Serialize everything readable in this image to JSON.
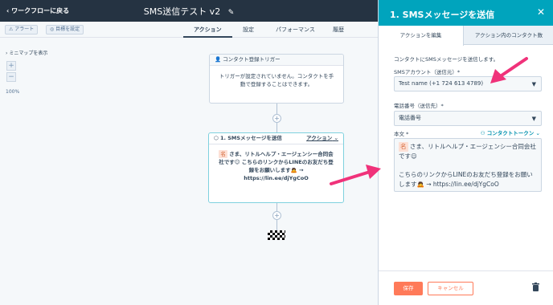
{
  "topbar": {
    "back_label": "‹ ワークフローに戻る",
    "title": "SMS送信テスト v2"
  },
  "toolbar": {
    "alert_label": "⚠ アラート",
    "goal_label": "◎ 目標を設定",
    "tabs": [
      {
        "label": "アクション",
        "active": true
      },
      {
        "label": "設定"
      },
      {
        "label": "パフォーマンス"
      },
      {
        "label": "履歴"
      }
    ]
  },
  "canvas": {
    "minimap_label": "ミニマップを表示",
    "zoom_in": "+",
    "zoom_out": "−",
    "zoom_level": "100%"
  },
  "trigger_card": {
    "title": "コンタクト登録トリガー",
    "body": "トリガーが設定されていません。コンタクトを手動で登録することはできます。"
  },
  "sms_card": {
    "title": "1. SMSメッセージを送信",
    "action_label": "アクション",
    "name_tag": "名",
    "message_line1": " さま、リトルヘルプ・エージェンシー合同会社です☺ こちらのリンクからLINEのお友だち登録をお願いします🙇 →",
    "message_link": "https://lin.ee/djYgCoO"
  },
  "panel": {
    "title": "1. SMSメッセージを送信",
    "tabs": [
      "アクションを編集",
      "アクション内のコンタクト数"
    ],
    "description": "コンタクトにSMSメッセージを送信します。",
    "account_label": "SMSアカウント（送信元）*",
    "account_value": "Test name (+1 724 613 4789)",
    "phone_label": "電話番号（送信先）*",
    "phone_value": "電話番号",
    "body_label": "本文 *",
    "token_label": "コンタクトトークン ⌄",
    "body_name_tag": "名",
    "body_line1": " さま、リトルヘルプ・エージェンシー合同会社です☺",
    "body_line2": "こちらのリンクからLINEのお友だち登録をお願いします🙇 → https://lin.ee/djYgCoO",
    "save_label": "保存",
    "cancel_label": "キャンセル"
  },
  "colors": {
    "topbar": "#253342",
    "panel_header": "#00a4bd",
    "accent": "#ff7a59",
    "annotation_arrow": "#f0327a"
  }
}
